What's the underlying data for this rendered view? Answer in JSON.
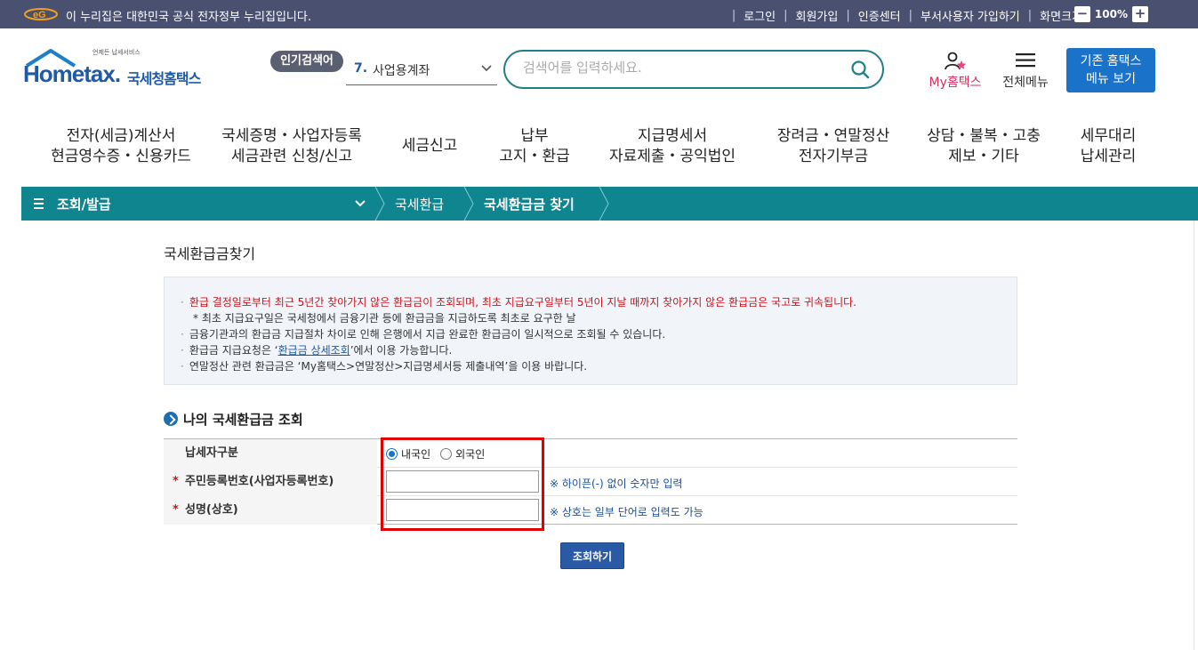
{
  "gov_bar": {
    "text": "이 누리집은 대한민국 공식 전자정부 누리집입니다.",
    "links": [
      "로그인",
      "회원가입",
      "인증센터",
      "부서사용자 가입하기",
      "화면크기"
    ],
    "zoom_level": "100%",
    "zoom_out": "−",
    "zoom_in": "+"
  },
  "header": {
    "logo_small": "언제든 납세서비스",
    "logo_main": "Hometax.",
    "logo_kr": "국세청홈택스",
    "popular_label": "인기검색어",
    "popular_rank": "7.",
    "popular_term": "사업용계좌",
    "search_placeholder": "검색어를 입력하세요.",
    "my_hometax": "My홈택스",
    "all_menu": "전체메뉴",
    "old_home_line1": "기존 홈택스",
    "old_home_line2": "메뉴 보기"
  },
  "main_nav": [
    {
      "line1": "전자(세금)계산서",
      "line2": "현금영수증・신용카드"
    },
    {
      "line1": "국세증명・사업자등록",
      "line2": "세금관련 신청/신고"
    },
    {
      "line1": "세금신고",
      "line2": ""
    },
    {
      "line1": "납부",
      "line2": "고지・환급"
    },
    {
      "line1": "지급명세서",
      "line2": "자료제출・공익법인"
    },
    {
      "line1": "장려금・연말정산",
      "line2": "전자기부금"
    },
    {
      "line1": "상담・불복・고충",
      "line2": "제보・기타"
    },
    {
      "line1": "세무대리",
      "line2": "납세관리"
    }
  ],
  "breadcrumb": {
    "menu_label": "조회/발급",
    "item1": "국세환급",
    "item2": "국세환급금 찾기"
  },
  "page": {
    "title": "국세환급금찾기",
    "notice": {
      "line1": "환급 결정일로부터 최근 5년간 찾아가지 않은 환급금이 조회되며, 최초 지급요구일부터 5년이 지날 때까지 찾아가지 않은 환급금은 국고로 귀속됩니다.",
      "line1_sub": "* 최초 지급요구일은 국세청에서 금융기관 등에 환급금을 지급하도록 최초로 요구한 날",
      "line2": "금융기관과의 환급금 지급절차 차이로 인해 은행에서 지급 완료한 환급금이 일시적으로 조회될 수 있습니다.",
      "line3_pre": "환급금 지급요청은 ‘",
      "line3_link": "환급금 상세조회",
      "line3_post": "’에서 이용 가능합니다.",
      "line4": "연말정산 관련 환급금은 ‘My홈택스>연말정산>지급명세서등 제출내역’을 이용 바랍니다."
    },
    "section_title": "나의 국세환급금 조회",
    "form": {
      "row1_label": "납세자구분",
      "radio1": "내국인",
      "radio2": "외국인",
      "row2_label": "주민등록번호(사업자등록번호)",
      "row2_hint": "※ 하이픈(-) 없이 숫자만 입력",
      "row3_label": "성명(상호)",
      "row3_hint": "※ 상호는 일부 단어로 입력도 가능",
      "required_mark": "*"
    },
    "search_button": "조회하기"
  },
  "colors": {
    "gov_bar": "#4a5170",
    "accent_teal": "#0f8590",
    "brand_blue": "#1f5aa6",
    "highlight_red": "#e10000"
  }
}
